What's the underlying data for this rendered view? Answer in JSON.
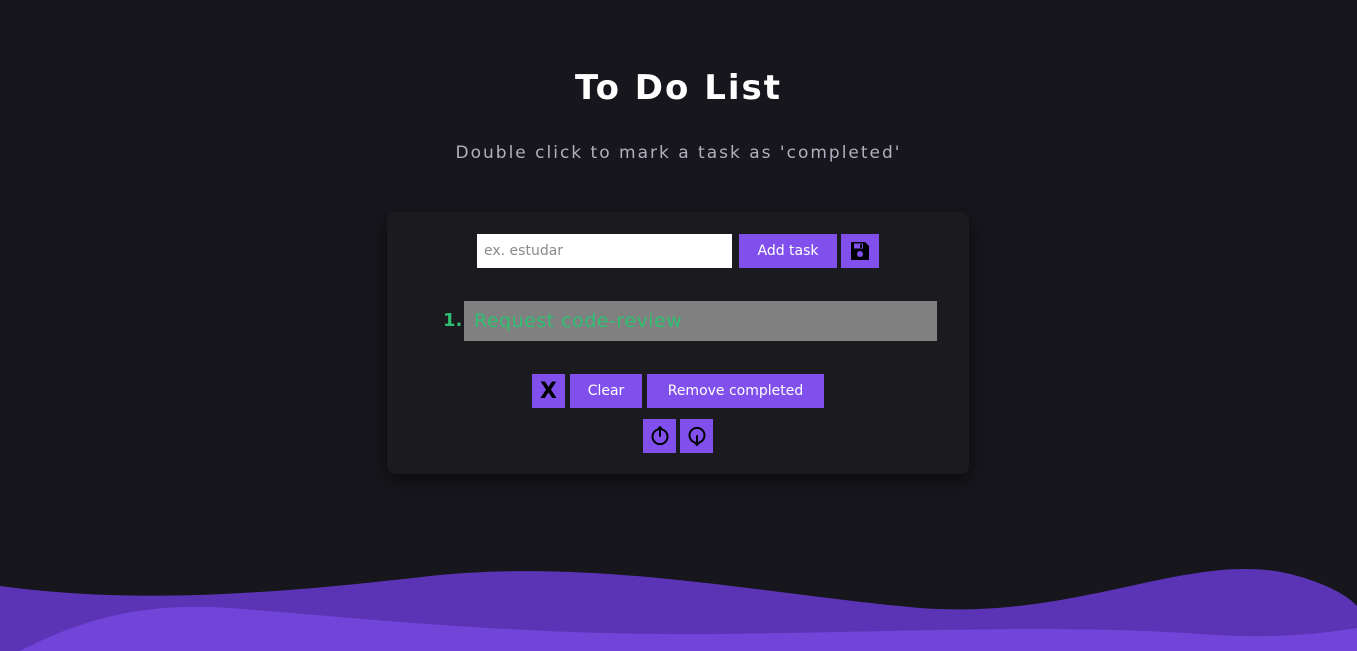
{
  "header": {
    "title": "To Do List",
    "subtitle": "Double click to mark a task as 'completed'"
  },
  "form": {
    "input_placeholder": "ex. estudar",
    "input_value": "",
    "add_label": "Add task",
    "save_icon": "floppy-disk-icon"
  },
  "tasks": [
    {
      "number": "1.",
      "text": "Request code-review",
      "completed": true
    }
  ],
  "actions": {
    "delete_label": "X",
    "clear_label": "Clear",
    "remove_completed_label": "Remove completed",
    "move_up_icon": "arrow-up-circle-icon",
    "move_down_icon": "arrow-down-circle-icon"
  },
  "colors": {
    "background": "#17161c",
    "card": "#1b1a1f",
    "accent": "#8150ec",
    "completed_text": "#2fbf71",
    "completed_bg": "#808080",
    "wave_back": "#5b34b5",
    "wave_front": "#7245d9"
  }
}
